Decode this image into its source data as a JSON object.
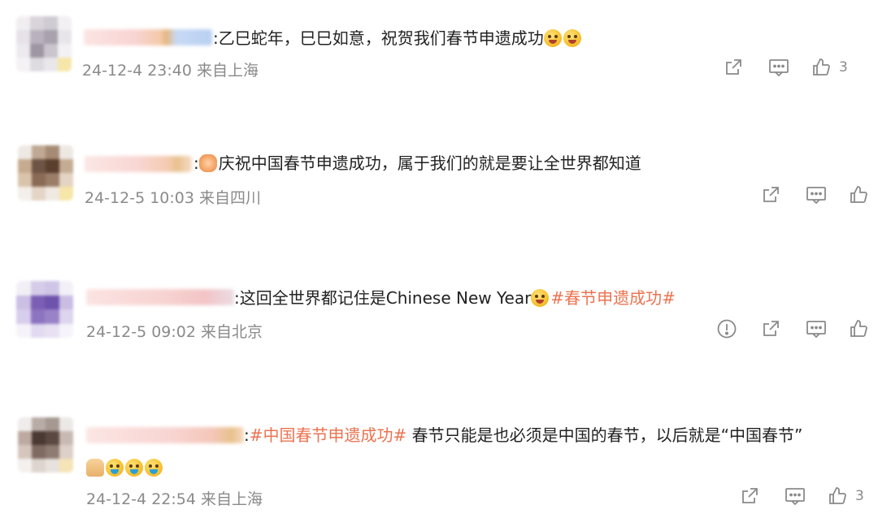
{
  "colors": {
    "text": "#222222",
    "meta": "#8a8a8a",
    "hashtag": "#eb7350",
    "background": "#ffffff"
  },
  "comments": [
    {
      "prefix": ":乙巳蛇年，巳巳如意，祝贺我们春节申遗成功",
      "hashtag": "",
      "suffix": "",
      "emojis": [
        "laughing-emoji",
        "surprised-emoji"
      ],
      "date": "24-12-4 23:40",
      "location": "来自上海",
      "likes": "3",
      "has_report": false
    },
    {
      "prefix": ":",
      "lead_emoji": "clapping-hands-emoji",
      "text": "庆祝中国春节申遗成功，属于我们的就是要让全世界都知道",
      "date": "24-12-5 10:03",
      "location": "来自四川",
      "likes": "",
      "has_report": false
    },
    {
      "prefix": ":这回全世界都记住是Chinese New Year",
      "emoji": "crying-emoji",
      "hashtag": "#春节申遗成功#",
      "date": "24-12-5 09:02",
      "location": "来自北京",
      "likes": "",
      "has_report": true
    },
    {
      "prefix": ":",
      "hashtag": "#中国春节申遗成功#",
      "suffix": " 春节只能是也必须是中国的春节，以后就是“中国春节”",
      "emojis_line2": [
        "thumbs-up-emoji",
        "teary-emoji",
        "teary-emoji",
        "teary-emoji"
      ],
      "date": "24-12-4 22:54",
      "location": "来自上海",
      "likes": "3",
      "has_report": false
    }
  ],
  "icons": {
    "share": "share-icon",
    "comment": "comment-icon",
    "like": "thumbs-up-icon",
    "report": "report-icon"
  }
}
